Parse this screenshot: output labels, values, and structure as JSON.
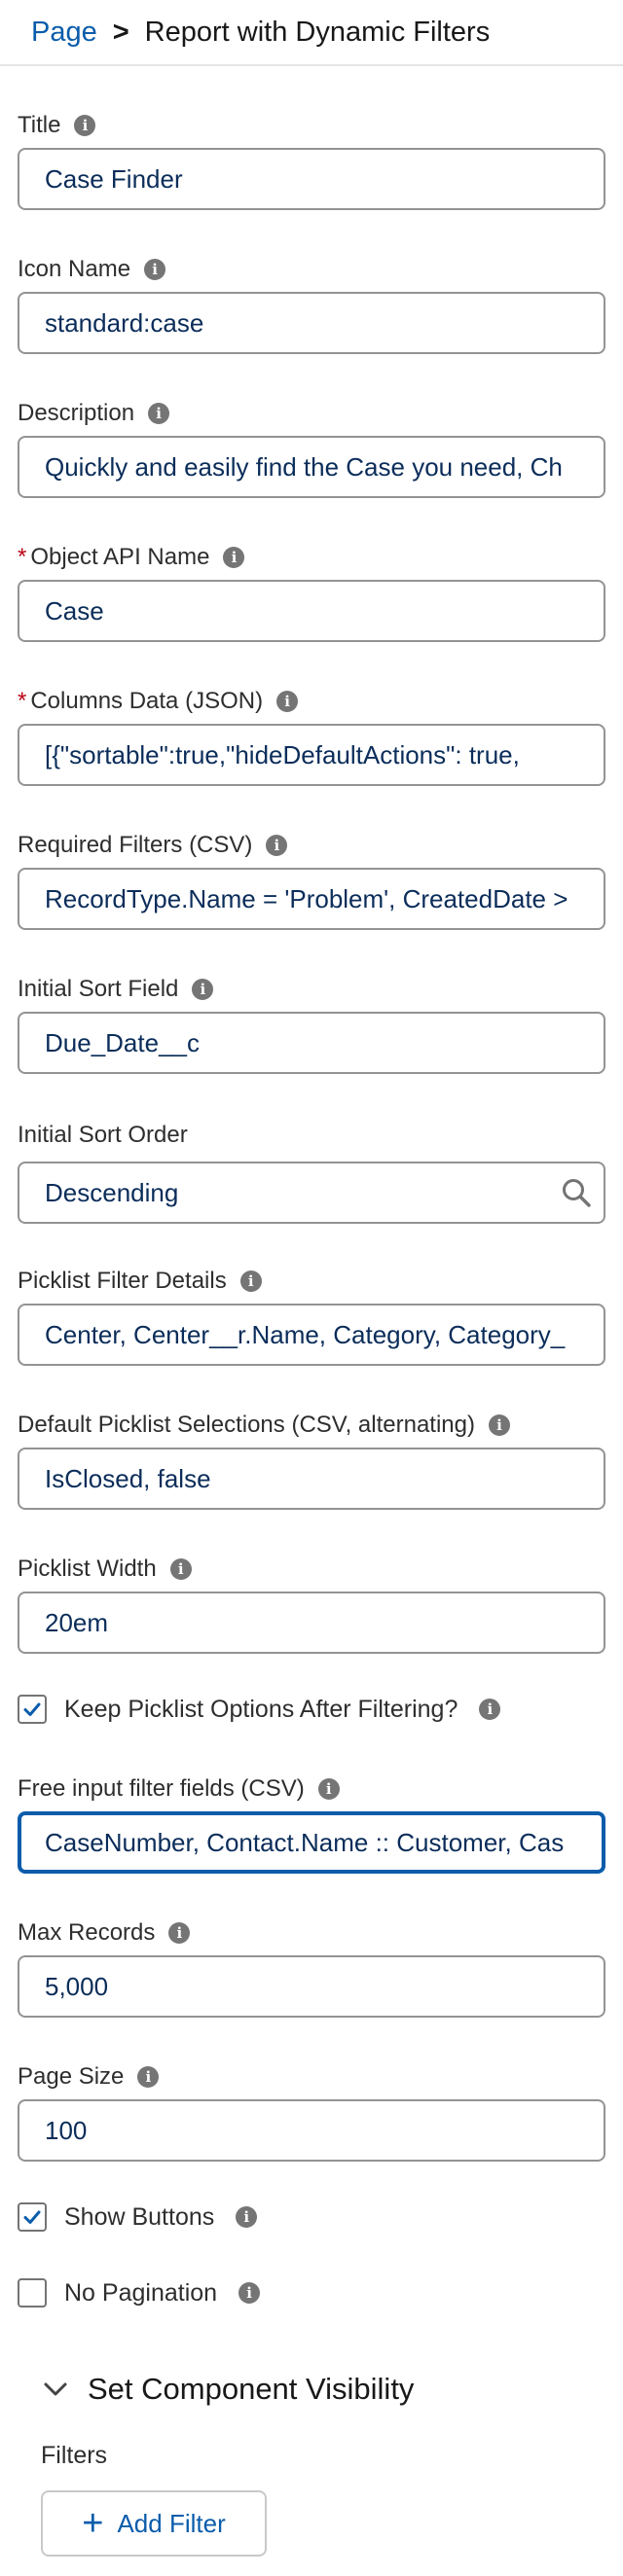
{
  "breadcrumb": {
    "parent": "Page",
    "separator": ">",
    "current": "Report with Dynamic Filters"
  },
  "info_glyph": "i",
  "required_mark": "*",
  "fields": {
    "title": {
      "label": "Title",
      "value": "Case Finder"
    },
    "icon_name": {
      "label": "Icon Name",
      "value": "standard:case"
    },
    "description": {
      "label": "Description",
      "value": "Quickly and easily find the Case you need, Ch"
    },
    "object_api_name": {
      "label": "Object API Name",
      "value": "Case",
      "required": true
    },
    "columns_data": {
      "label": "Columns Data (JSON)",
      "value": "[{\"sortable\":true,\"hideDefaultActions\": true,",
      "required": true
    },
    "required_filters": {
      "label": "Required Filters (CSV)",
      "value": "RecordType.Name = 'Problem', CreatedDate >"
    },
    "initial_sort_field": {
      "label": "Initial Sort Field",
      "value": "Due_Date__c"
    },
    "initial_sort_order": {
      "label": "Initial Sort Order",
      "value": "Descending"
    },
    "picklist_filter_details": {
      "label": "Picklist Filter Details",
      "value": "Center, Center__r.Name, Category, Category_"
    },
    "default_picklist_selections": {
      "label": "Default Picklist Selections (CSV, alternating)",
      "value": "IsClosed, false"
    },
    "picklist_width": {
      "label": "Picklist Width",
      "value": "20em"
    },
    "free_input_filter_fields": {
      "label": "Free input filter fields (CSV)",
      "value": "CaseNumber, Contact.Name :: Customer, Cas"
    },
    "max_records": {
      "label": "Max Records",
      "value": "5,000"
    },
    "page_size": {
      "label": "Page Size",
      "value": "100"
    }
  },
  "checkboxes": {
    "keep_picklist": {
      "label": "Keep Picklist Options After Filtering?",
      "checked": true
    },
    "show_buttons": {
      "label": "Show Buttons",
      "checked": true
    },
    "no_pagination": {
      "label": "No Pagination",
      "checked": false
    }
  },
  "visibility": {
    "label": "Set Component Visibility",
    "expanded": true
  },
  "filters": {
    "label": "Filters",
    "add_button": "Add Filter",
    "add_icon": "+"
  },
  "colors": {
    "accent": "#0b5cab",
    "required": "#ba0517",
    "border": "#939393"
  }
}
